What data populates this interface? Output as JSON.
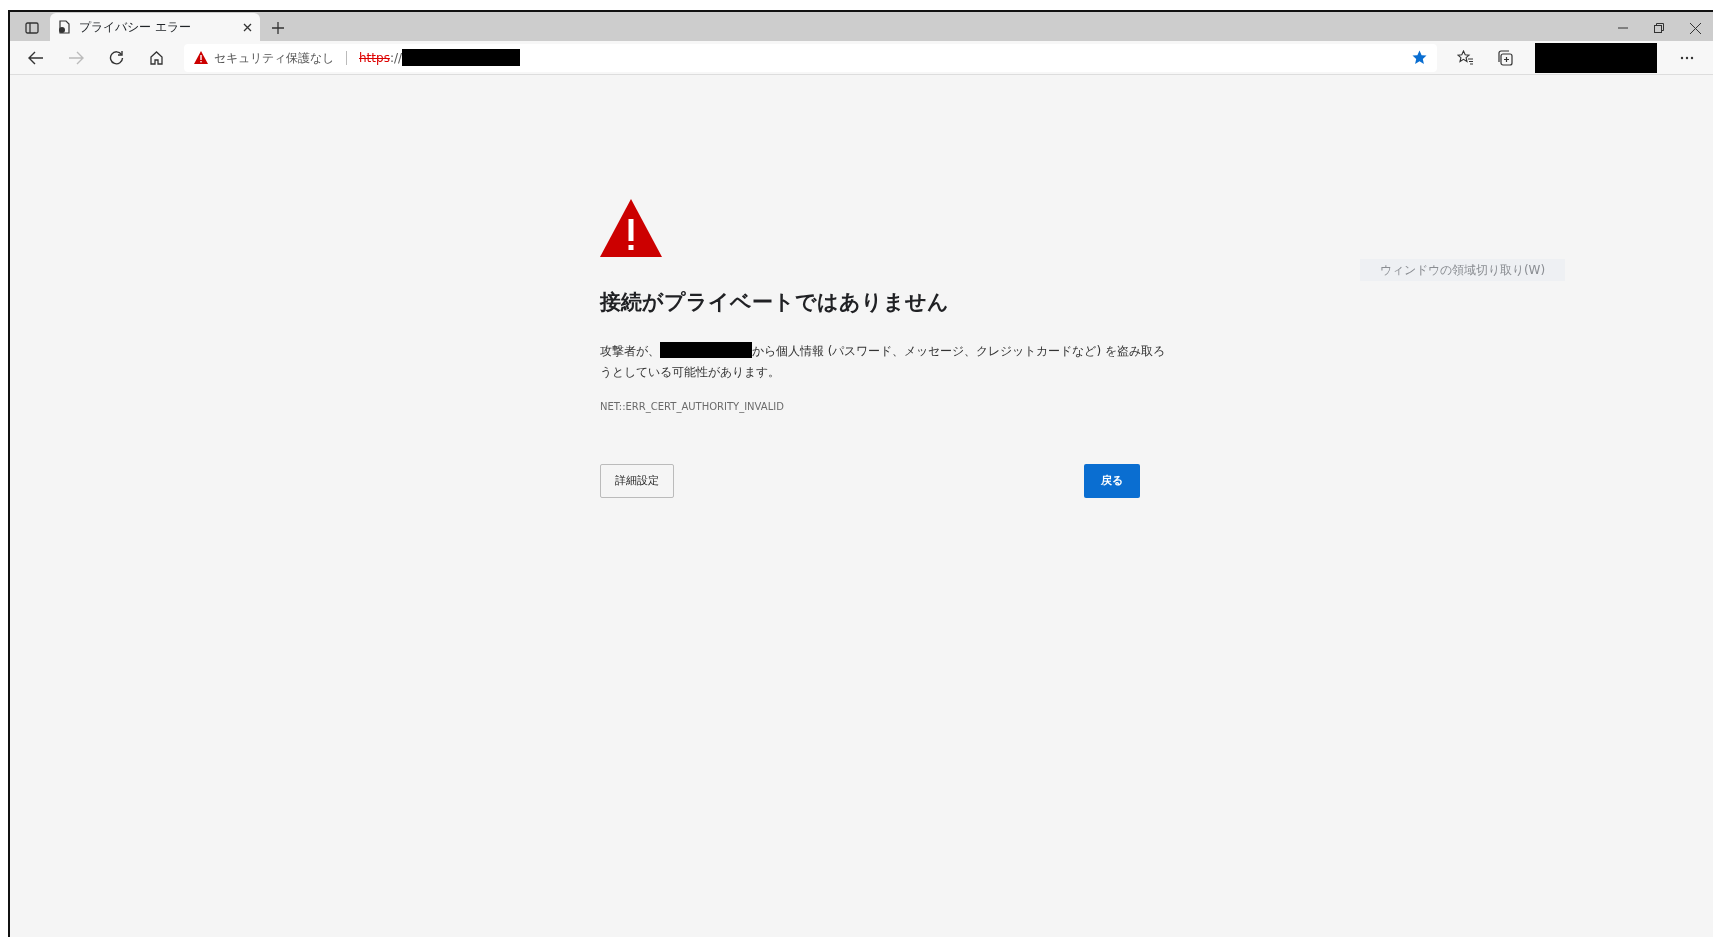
{
  "tabs": [
    {
      "title": "プライバシー エラー",
      "selected": true
    }
  ],
  "address_bar": {
    "security_label": "セキュリティ保護なし",
    "scheme": "https",
    "separator": "://",
    "host_redacted": true
  },
  "favorite_saved": true,
  "profile_redacted": true,
  "page": {
    "title": "接続がプライベートではありません",
    "message_before": "攻撃者が、",
    "message_redacted": true,
    "message_after": "から個人情報 (パスワード、メッセージ、クレジットカードなど) を盗み取ろうとしている可能性があります。",
    "error_code": "NET::ERR_CERT_AUTHORITY_INVALID",
    "buttons": [
      {
        "label": "詳細設定",
        "kind": "secondary"
      },
      {
        "label": "戻る",
        "kind": "primary"
      }
    ]
  },
  "ghost_tooltip": "ウィンドウの領域切り取り(W)"
}
